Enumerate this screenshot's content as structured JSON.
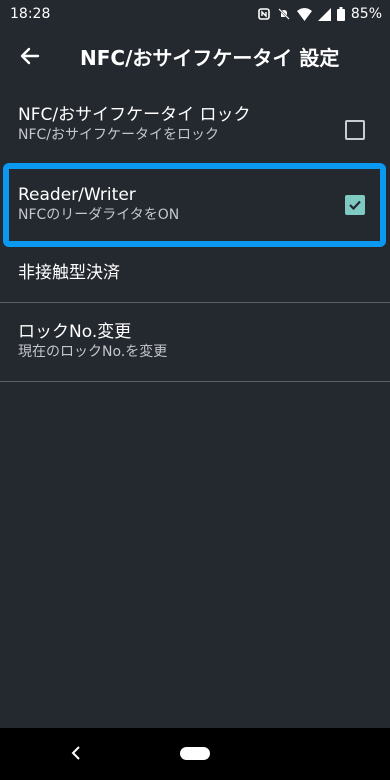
{
  "status": {
    "time": "18:28",
    "battery": "85%"
  },
  "appbar": {
    "title": "NFC/おサイフケータイ 設定"
  },
  "list": [
    {
      "primary": "NFC/おサイフケータイ ロック",
      "secondary": "NFC/おサイフケータイをロック",
      "checked": false
    },
    {
      "primary": "Reader/Writer",
      "secondary": "NFCのリーダライタをON",
      "checked": true
    },
    {
      "primary": "非接触型決済"
    },
    {
      "primary": "ロックNo.変更",
      "secondary": "現在のロックNo.を変更"
    }
  ],
  "colors": {
    "background": "#24282f",
    "accent": "#7fcbc4",
    "highlight": "#0a98f0"
  }
}
